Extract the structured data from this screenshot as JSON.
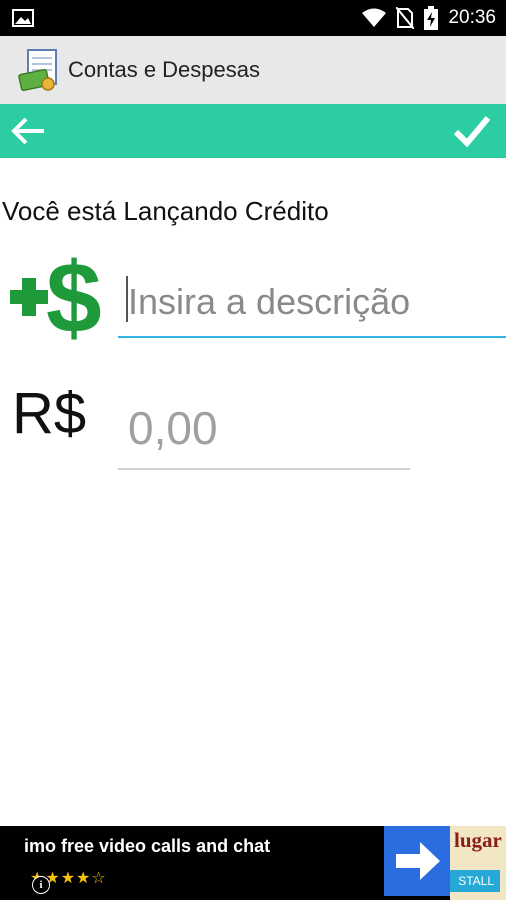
{
  "status_bar": {
    "time": "20:36",
    "icons": [
      "image-notification-icon",
      "wifi-icon",
      "no-sim-icon",
      "battery-charging-icon"
    ]
  },
  "app": {
    "title": "Contas e Despesas",
    "icon": "ledger-money-icon"
  },
  "toolbar": {
    "back_icon": "arrow-left-icon",
    "confirm_icon": "checkmark-icon",
    "color": "#2dcda3"
  },
  "form": {
    "mode_label": "Você está Lançando Crédito",
    "credit_icon": "plus-dollar-icon",
    "description_placeholder": "Insira a descrição",
    "currency_symbol": "R$",
    "amount_placeholder": "0,00",
    "accent_color": "#33b5e5"
  },
  "ad": {
    "title": "imo free video calls and chat",
    "rating": "★★★★☆",
    "brand": "lugar",
    "install_label": "STALL"
  }
}
